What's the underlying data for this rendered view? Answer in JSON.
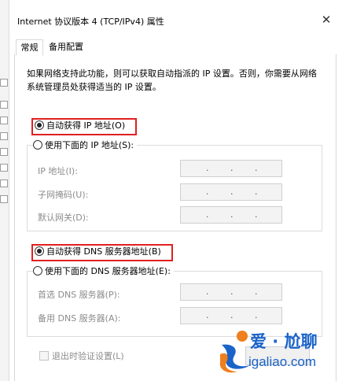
{
  "window": {
    "title": "Internet 协议版本 4 (TCP/IPv4) 属性",
    "close_glyph": "✕"
  },
  "tabs": [
    {
      "label": "常规"
    },
    {
      "label": "备用配置"
    }
  ],
  "description": "如果网络支持此功能，则可以获取自动指派的 IP 设置。否则，你需要从网络系统管理员处获得适当的 IP 设置。",
  "ip": {
    "auto_label": "自动获得 IP 地址(O)",
    "manual_label": "使用下面的 IP 地址(S):",
    "auto_selected": true,
    "fields": [
      {
        "label": "IP 地址(I):"
      },
      {
        "label": "子网掩码(U):"
      },
      {
        "label": "默认网关(D):"
      }
    ]
  },
  "dns": {
    "auto_label": "自动获得 DNS 服务器地址(B)",
    "manual_label": "使用下面的 DNS 服务器地址(E):",
    "auto_selected": true,
    "fields": [
      {
        "label": "首选 DNS 服务器(P):"
      },
      {
        "label": "备用 DNS 服务器(A):"
      }
    ]
  },
  "validate_label": "退出时验证设置(L)",
  "ip_separator": ".",
  "watermark": {
    "main": "爱 · 尬聊",
    "url": "igaliao.com"
  },
  "colors": {
    "highlight": "#e02020",
    "watermark": "#1a63c9"
  }
}
